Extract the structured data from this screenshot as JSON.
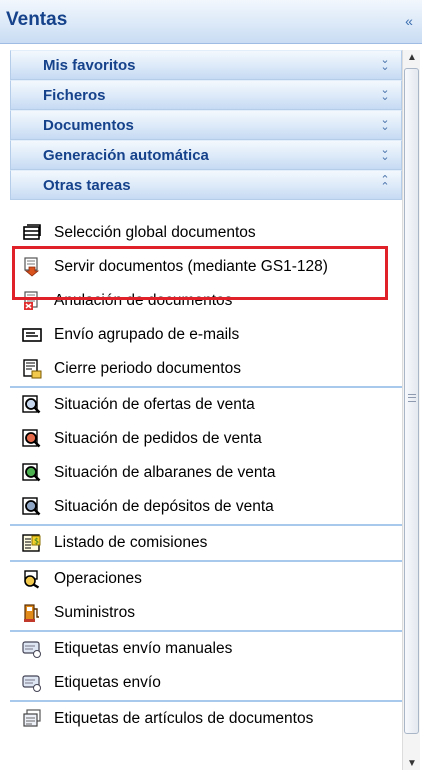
{
  "panel": {
    "title": "Ventas",
    "collapse_icon": "double-chevron-left-icon"
  },
  "groups": [
    {
      "label": "Mis favoritos",
      "state": "collapsed"
    },
    {
      "label": "Ficheros",
      "state": "collapsed"
    },
    {
      "label": "Documentos",
      "state": "collapsed"
    },
    {
      "label": "Generación automática",
      "state": "collapsed"
    },
    {
      "label": "Otras tareas",
      "state": "expanded"
    }
  ],
  "tasks": [
    {
      "label": "Selección global documentos",
      "icon": "documents-stack-icon"
    },
    {
      "label": "Servir documentos (mediante GS1-128)",
      "icon": "document-down-arrow-icon"
    },
    {
      "label": "Anulación de documentos",
      "icon": "document-cancel-icon"
    },
    {
      "label": "Envío agrupado de e-mails",
      "icon": "email-icon"
    },
    {
      "label": "Cierre periodo documentos",
      "icon": "document-lock-icon"
    },
    {
      "label": "Situación de ofertas de venta",
      "icon": "magnifier-document-icon"
    },
    {
      "label": "Situación de pedidos de venta",
      "icon": "magnifier-document-red-icon"
    },
    {
      "label": "Situación de albaranes de venta",
      "icon": "magnifier-document-green-icon"
    },
    {
      "label": "Situación de depósitos de venta",
      "icon": "magnifier-document-dark-icon"
    },
    {
      "label": "Listado de comisiones",
      "icon": "money-list-icon"
    },
    {
      "label": "Operaciones",
      "icon": "operations-icon"
    },
    {
      "label": "Suministros",
      "icon": "fuel-pump-icon"
    },
    {
      "label": "Etiquetas envío manuales",
      "icon": "label-hand-icon"
    },
    {
      "label": "Etiquetas envío",
      "icon": "label-icon"
    },
    {
      "label": "Etiquetas de artículos de documentos",
      "icon": "article-labels-icon"
    }
  ],
  "colors": {
    "header_text": "#15428b",
    "highlight_border": "#e0212a",
    "separator": "#a8c8ec"
  }
}
